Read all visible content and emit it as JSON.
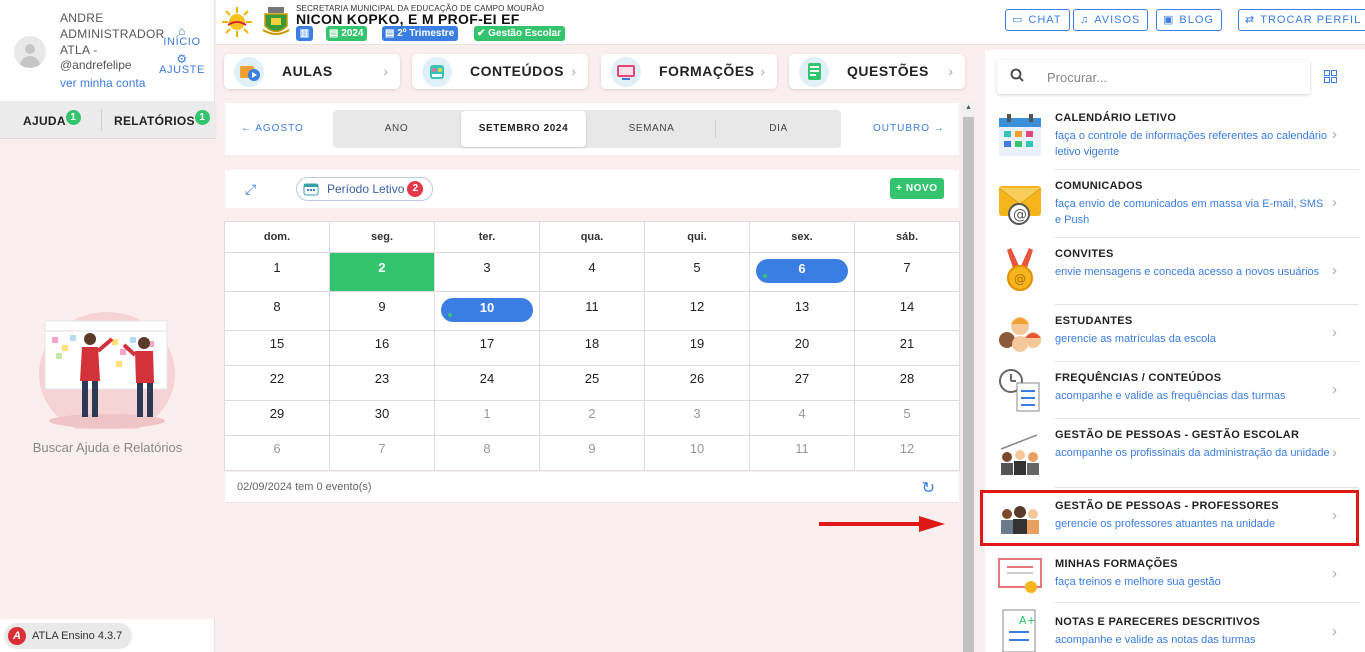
{
  "profile": {
    "name": "ANDRE ADMINISTRADOR ATLA -",
    "username": "@andrefelipe",
    "account_link": "ver minha conta",
    "home_label": "INÍCIO",
    "settings_label": "AJUSTE"
  },
  "side_tabs": [
    {
      "label": "AJUDA",
      "badge": "1"
    },
    {
      "label": "RELATÓRIOS",
      "badge": "1"
    }
  ],
  "help_text": "Buscar Ajuda e Relatórios",
  "version": "ATLA Ensino 4.3.7",
  "header": {
    "secretariat": "SECRETARIA MUNICIPAL DA EDUCAÇÃO DE CAMPO MOURÃO",
    "school": "NICON KOPKO, E M PROF-EI EF",
    "year": "2024",
    "term": "2º Trimestre",
    "school_mgmt": "Gestão Escolar",
    "buttons": [
      "CHAT",
      "AVISOS",
      "BLOG",
      "TROCAR PERFIL"
    ]
  },
  "modules": [
    "AULAS",
    "CONTEÚDOS",
    "FORMAÇÕES",
    "QUESTÕES"
  ],
  "calendar": {
    "prev": "AGOSTO",
    "next": "OUTUBRO",
    "views": [
      "ANO",
      "SETEMBRO 2024",
      "SEMANA",
      "DIA"
    ],
    "period_label": "Período Letivo",
    "period_count": "2",
    "new_label": "NOVO",
    "weekdays": [
      "dom.",
      "seg.",
      "ter.",
      "qua.",
      "qui.",
      "sex.",
      "sáb."
    ],
    "weeks": [
      [
        "1",
        "2",
        "3",
        "4",
        "5",
        "6",
        "7"
      ],
      [
        "8",
        "9",
        "10",
        "11",
        "12",
        "13",
        "14"
      ],
      [
        "15",
        "16",
        "17",
        "18",
        "19",
        "20",
        "21"
      ],
      [
        "22",
        "23",
        "24",
        "25",
        "26",
        "27",
        "28"
      ],
      [
        "29",
        "30",
        "1",
        "2",
        "3",
        "4",
        "5"
      ],
      [
        "6",
        "7",
        "8",
        "9",
        "10",
        "11",
        "12"
      ]
    ],
    "footer": "02/09/2024 tem 0 evento(s)"
  },
  "search": {
    "placeholder": "Procurar..."
  },
  "apps": [
    {
      "title": "CALENDÁRIO LETIVO",
      "desc": "faça o controle de informações referentes ao calendário letivo vigente"
    },
    {
      "title": "COMUNICADOS",
      "desc": "faça envio de comunicados em massa via E-mail, SMS e Push"
    },
    {
      "title": "CONVITES",
      "desc": "envie mensagens e conceda acesso a novos usuários"
    },
    {
      "title": "ESTUDANTES",
      "desc": "gerencie as matrículas da escola"
    },
    {
      "title": "FREQUÊNCIAS / CONTEÚDOS",
      "desc": "acompanhe e valide as frequências das turmas"
    },
    {
      "title": "GESTÃO DE PESSOAS - GESTÃO ESCOLAR",
      "desc": "acompanhe os profissinais da administração da unidade"
    },
    {
      "title": "GESTÃO DE PESSOAS - PROFESSORES",
      "desc": "gerencie os professores atuantes na unidade"
    },
    {
      "title": "MINHAS FORMAÇÕES",
      "desc": "faça treinos e melhore sua gestão"
    },
    {
      "title": "NOTAS E PARECERES DESCRITIVOS",
      "desc": "acompanhe e valide as notas das turmas"
    }
  ],
  "colors": {
    "accent": "#3a7de3",
    "success": "#35c46e",
    "danger": "#e01717",
    "background": "#fbeeee"
  }
}
